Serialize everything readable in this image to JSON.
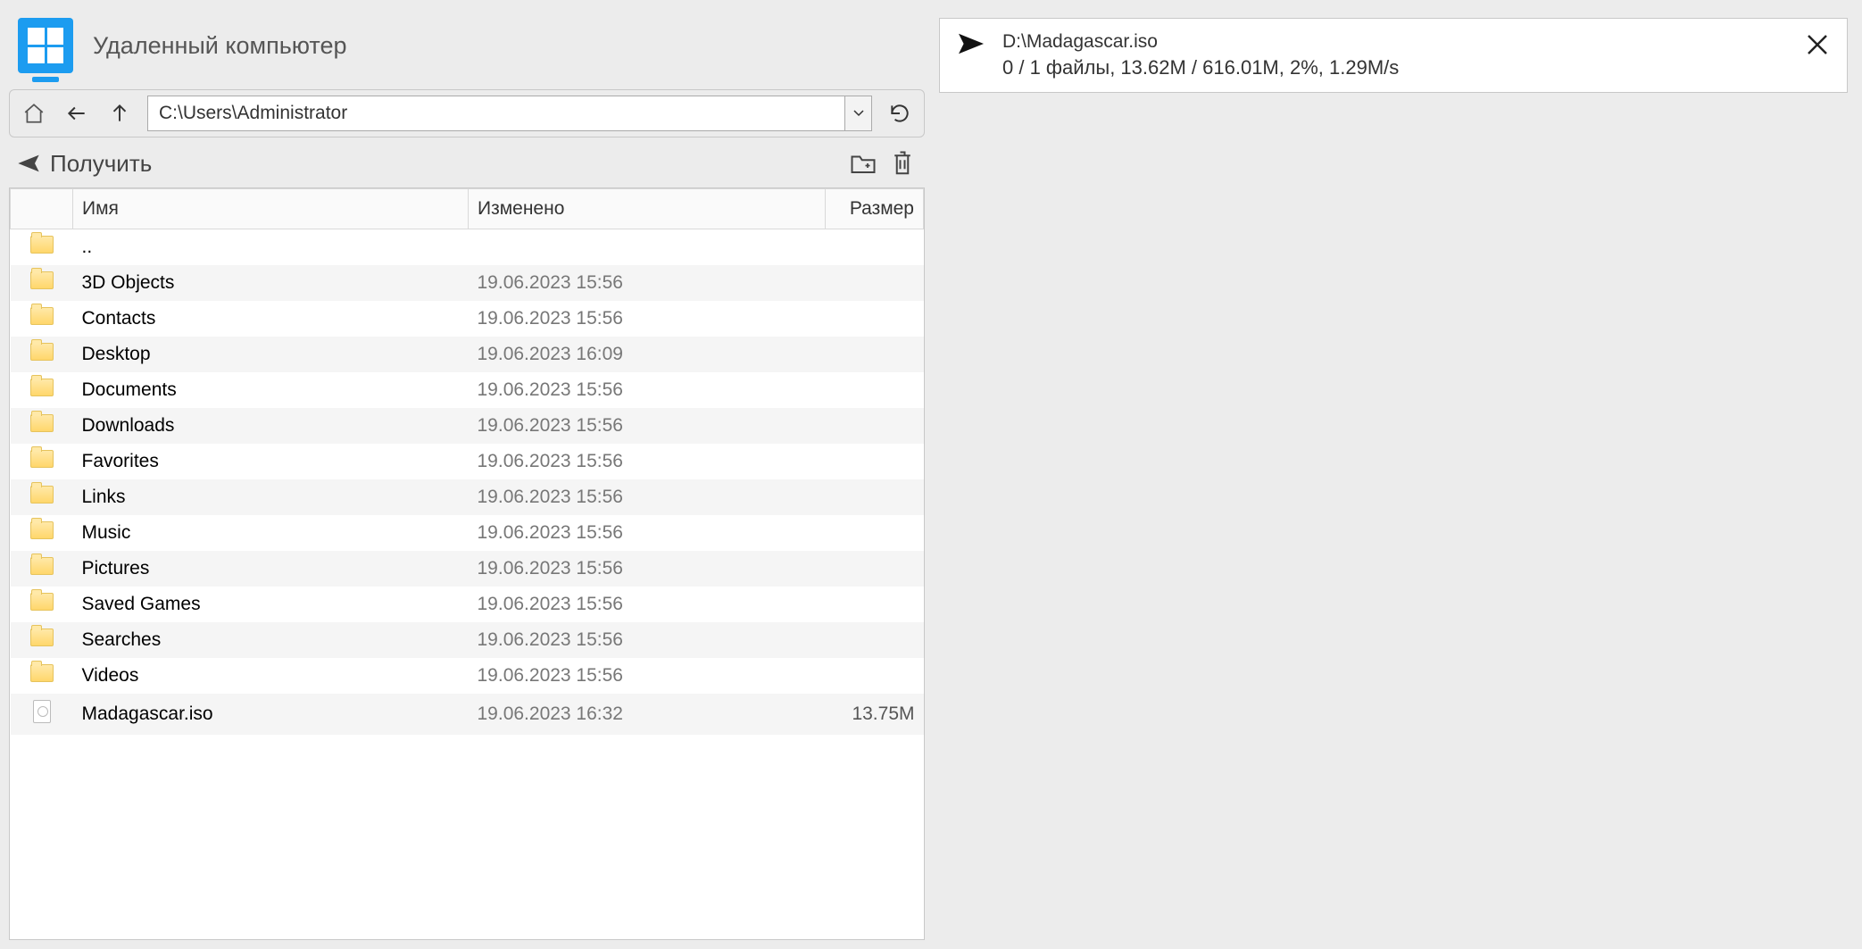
{
  "header": {
    "title": "Удаленный компьютер"
  },
  "nav": {
    "path": "C:\\Users\\Administrator"
  },
  "actions": {
    "get_label": "Получить"
  },
  "columns": {
    "name": "Имя",
    "modified": "Изменено",
    "size": "Размер"
  },
  "files": [
    {
      "icon": "folder",
      "name": "..",
      "modified": "",
      "size": ""
    },
    {
      "icon": "folder",
      "name": "3D Objects",
      "modified": "19.06.2023 15:56",
      "size": ""
    },
    {
      "icon": "folder",
      "name": "Contacts",
      "modified": "19.06.2023 15:56",
      "size": ""
    },
    {
      "icon": "folder",
      "name": "Desktop",
      "modified": "19.06.2023 16:09",
      "size": ""
    },
    {
      "icon": "folder",
      "name": "Documents",
      "modified": "19.06.2023 15:56",
      "size": ""
    },
    {
      "icon": "folder",
      "name": "Downloads",
      "modified": "19.06.2023 15:56",
      "size": ""
    },
    {
      "icon": "folder",
      "name": "Favorites",
      "modified": "19.06.2023 15:56",
      "size": ""
    },
    {
      "icon": "folder",
      "name": "Links",
      "modified": "19.06.2023 15:56",
      "size": ""
    },
    {
      "icon": "folder",
      "name": "Music",
      "modified": "19.06.2023 15:56",
      "size": ""
    },
    {
      "icon": "folder",
      "name": "Pictures",
      "modified": "19.06.2023 15:56",
      "size": ""
    },
    {
      "icon": "folder",
      "name": "Saved Games",
      "modified": "19.06.2023 15:56",
      "size": ""
    },
    {
      "icon": "folder",
      "name": "Searches",
      "modified": "19.06.2023 15:56",
      "size": ""
    },
    {
      "icon": "folder",
      "name": "Videos",
      "modified": "19.06.2023 15:56",
      "size": ""
    },
    {
      "icon": "iso",
      "name": "Madagascar.iso",
      "modified": "19.06.2023 16:32",
      "size": "13.75M"
    }
  ],
  "transfer": {
    "path": "D:\\Madagascar.iso",
    "stats": "0 / 1 файлы, 13.62M / 616.01M, 2%, 1.29M/s"
  }
}
